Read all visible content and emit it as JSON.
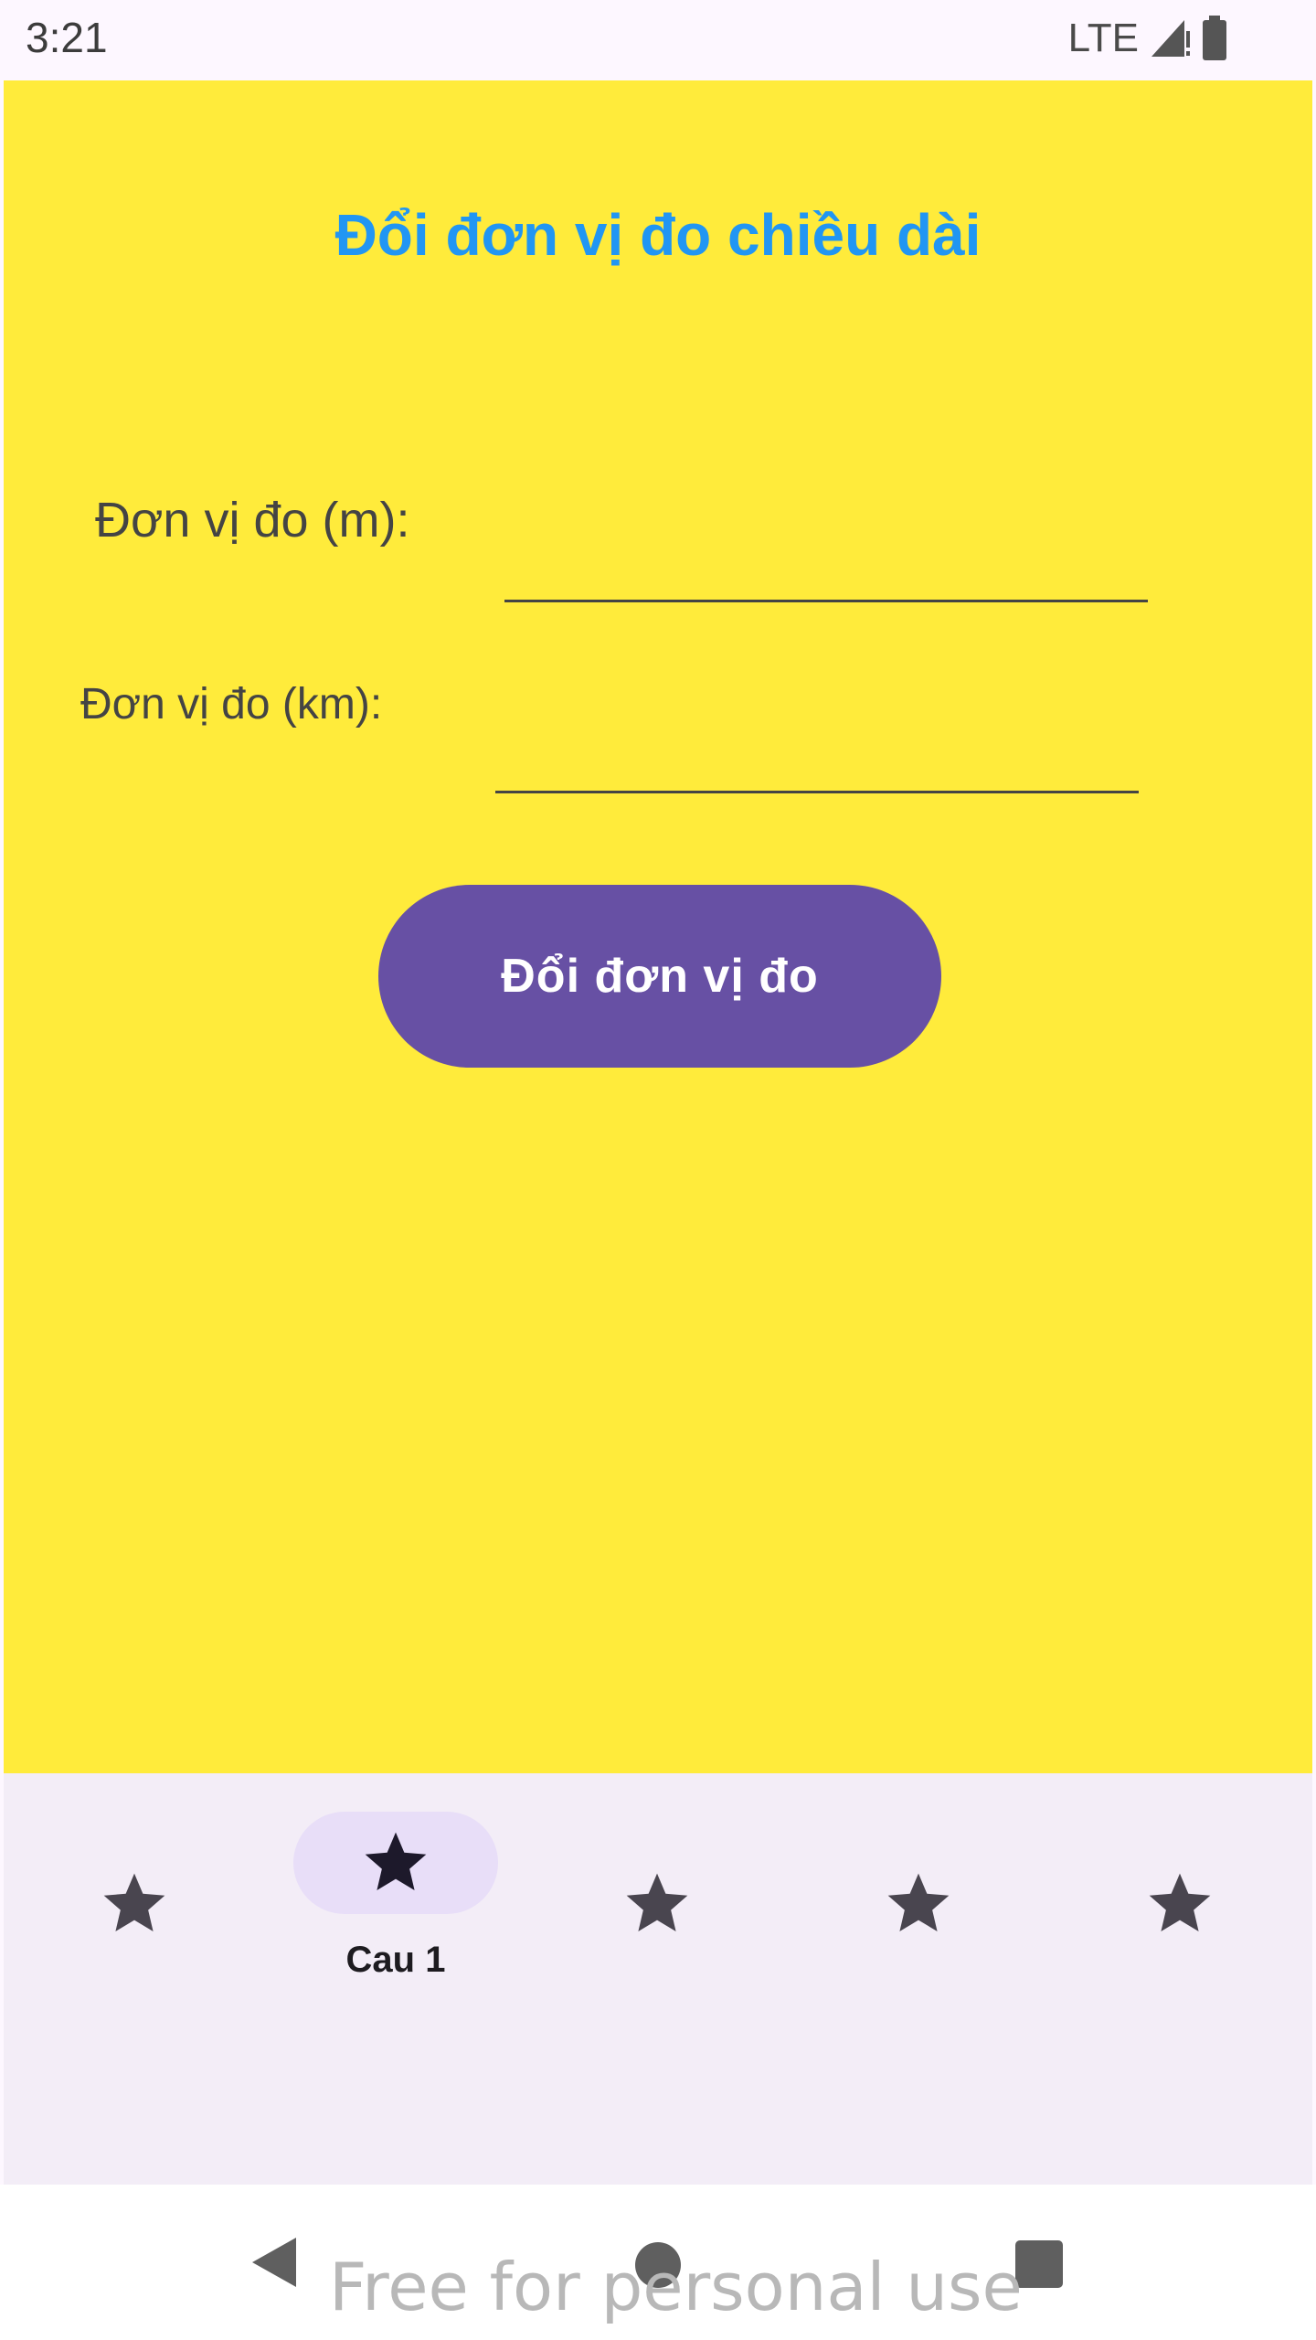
{
  "status_bar": {
    "time": "3:21",
    "network": "LTE",
    "icons": [
      "signal-icon",
      "battery-icon"
    ]
  },
  "main": {
    "title": "Đổi đơn vị đo chiều dài",
    "meter_label": "Đơn vị đo (m):",
    "meter_value": "",
    "km_label": "Đơn vị đo (km):",
    "km_value": "",
    "convert_button": "Đổi đơn vị đo"
  },
  "bottom_nav": {
    "items": [
      {
        "label": "",
        "icon": "star-icon",
        "selected": false
      },
      {
        "label": "Cau 1",
        "icon": "star-icon",
        "selected": true
      },
      {
        "label": "",
        "icon": "star-icon",
        "selected": false
      },
      {
        "label": "",
        "icon": "star-icon",
        "selected": false
      },
      {
        "label": "",
        "icon": "star-icon",
        "selected": false
      }
    ]
  },
  "system_nav": {
    "icons": [
      "back-icon",
      "home-icon",
      "recents-icon"
    ]
  },
  "watermark": "Free for personal use",
  "colors": {
    "background": "#ffeb3b",
    "title": "#2196f3",
    "button": "#6750a4",
    "nav_background": "#f3edf7",
    "nav_indicator": "#e8def8"
  }
}
